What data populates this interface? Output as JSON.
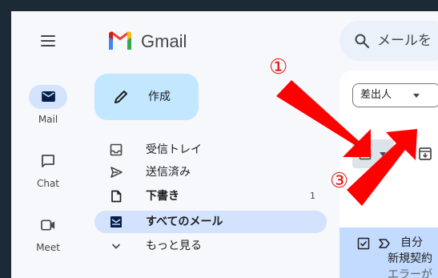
{
  "header": {
    "app_name": "Gmail",
    "search_placeholder": "メールを"
  },
  "rail": [
    {
      "label": "Mail",
      "icon": "mail-icon",
      "active": true
    },
    {
      "label": "Chat",
      "icon": "chat-icon",
      "active": false
    },
    {
      "label": "Meet",
      "icon": "meet-icon",
      "active": false
    }
  ],
  "compose": {
    "label": "作成"
  },
  "nav": [
    {
      "label": "受信トレイ",
      "icon": "inbox-icon",
      "count": "",
      "bold": false,
      "active": false
    },
    {
      "label": "送信済み",
      "icon": "send-icon",
      "count": "",
      "bold": false,
      "active": false
    },
    {
      "label": "下書き",
      "icon": "draft-icon",
      "count": "1",
      "bold": true,
      "active": false
    },
    {
      "label": "すべてのメール",
      "icon": "all-mail-icon",
      "count": "",
      "bold": true,
      "active": true
    },
    {
      "label": "もっと見る",
      "icon": "chevron-down-icon",
      "count": "",
      "bold": false,
      "active": false
    }
  ],
  "filter_chip": {
    "label": "差出人"
  },
  "email_row": {
    "sender": "自分",
    "subject": "新規契約",
    "snippet": "エラーが"
  },
  "annotations": {
    "step1": "①",
    "step3": "③",
    "arrow_color": "#ff0000"
  },
  "colors": {
    "frame": "#1b2a35",
    "background": "#f6f8fc",
    "compose": "#c2e7ff",
    "active_nav": "#d3e3fd",
    "selected_row": "#c2dbff"
  }
}
